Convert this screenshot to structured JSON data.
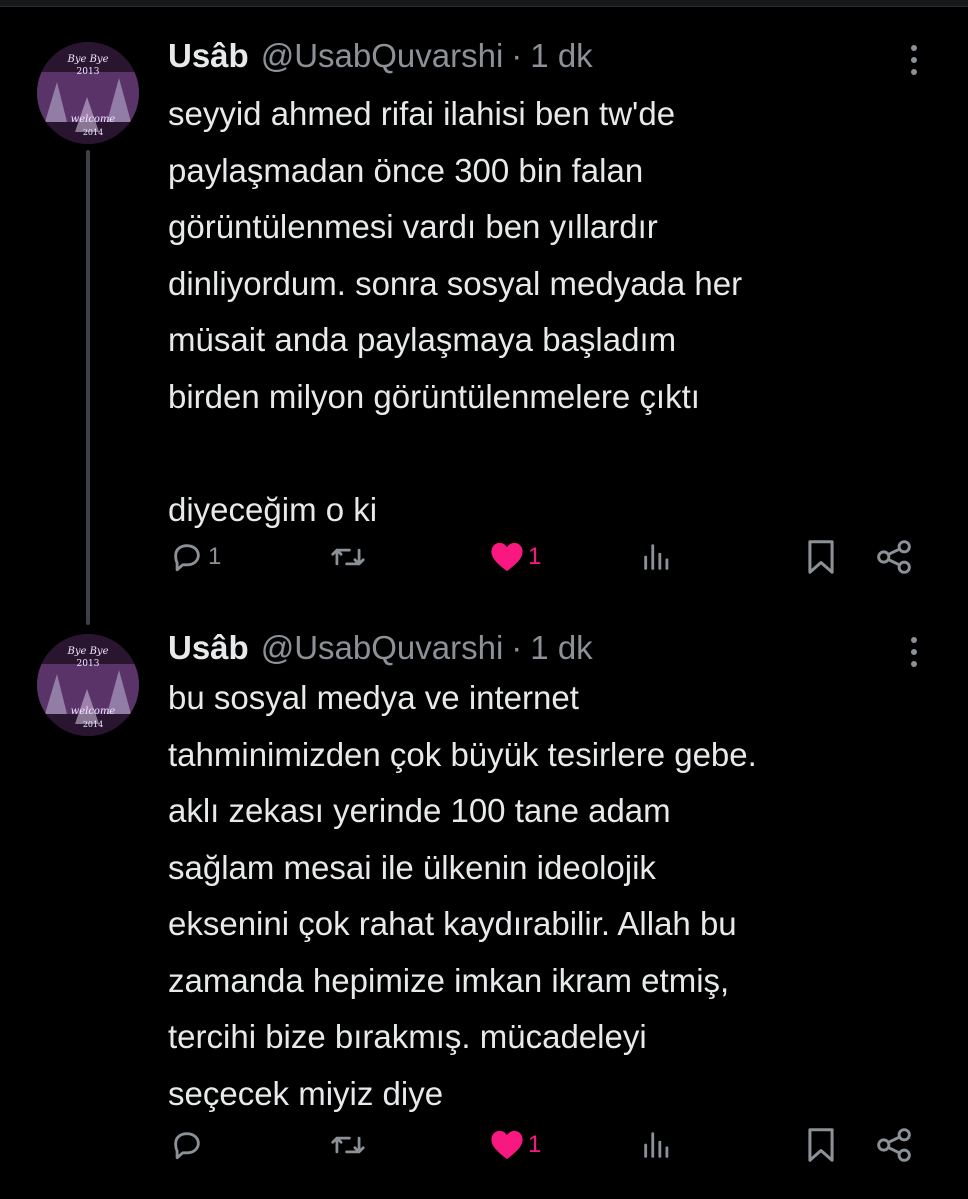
{
  "colors": {
    "background": "#000000",
    "text": "#e7e9ea",
    "secondary": "#8b9196",
    "like": "#f91880",
    "thread_line": "#3d4145"
  },
  "tweets": [
    {
      "avatar": {
        "lines": [
          "Bye Bye",
          "2013",
          "welcome",
          "2014"
        ]
      },
      "name": "Usâb",
      "handle": "@UsabQuvarshi",
      "separator": "·",
      "time": "1 dk",
      "text": "seyyid ahmed rifai ilahisi ben tw'de\npaylaşmadan önce 300 bin falan\ngörüntülenmesi vardı ben yıllardır\ndinliyordum. sonra sosyal medyada her\nmüsait anda paylaşmaya başladım\nbirden milyon görüntülenmelere çıktı\n\ndiyeceğim o ki",
      "replies": "1",
      "retweets": "",
      "likes": "1",
      "views": "",
      "liked": true
    },
    {
      "avatar": {
        "lines": [
          "Bye Bye",
          "2013",
          "welcome",
          "2014"
        ]
      },
      "name": "Usâb",
      "handle": "@UsabQuvarshi",
      "separator": "·",
      "time": "1 dk",
      "text": "bu sosyal medya ve internet\ntahminimizden çok büyük tesirlere gebe.\naklı zekası yerinde 100 tane adam\nsağlam mesai ile ülkenin ideolojik\neksenini çok rahat kaydırabilir. Allah bu\nzamanda hepimize imkan ikram etmiş,\ntercihi bize bırakmış. mücadeleyi\nseçecek miyiz diye",
      "replies": "",
      "retweets": "",
      "likes": "1",
      "views": "",
      "liked": true
    }
  ],
  "icons": {
    "reply": "reply-icon",
    "retweet": "retweet-icon",
    "like": "heart-icon",
    "views": "views-icon",
    "bookmark": "bookmark-icon",
    "share": "share-icon",
    "more": "more-vertical-icon"
  }
}
